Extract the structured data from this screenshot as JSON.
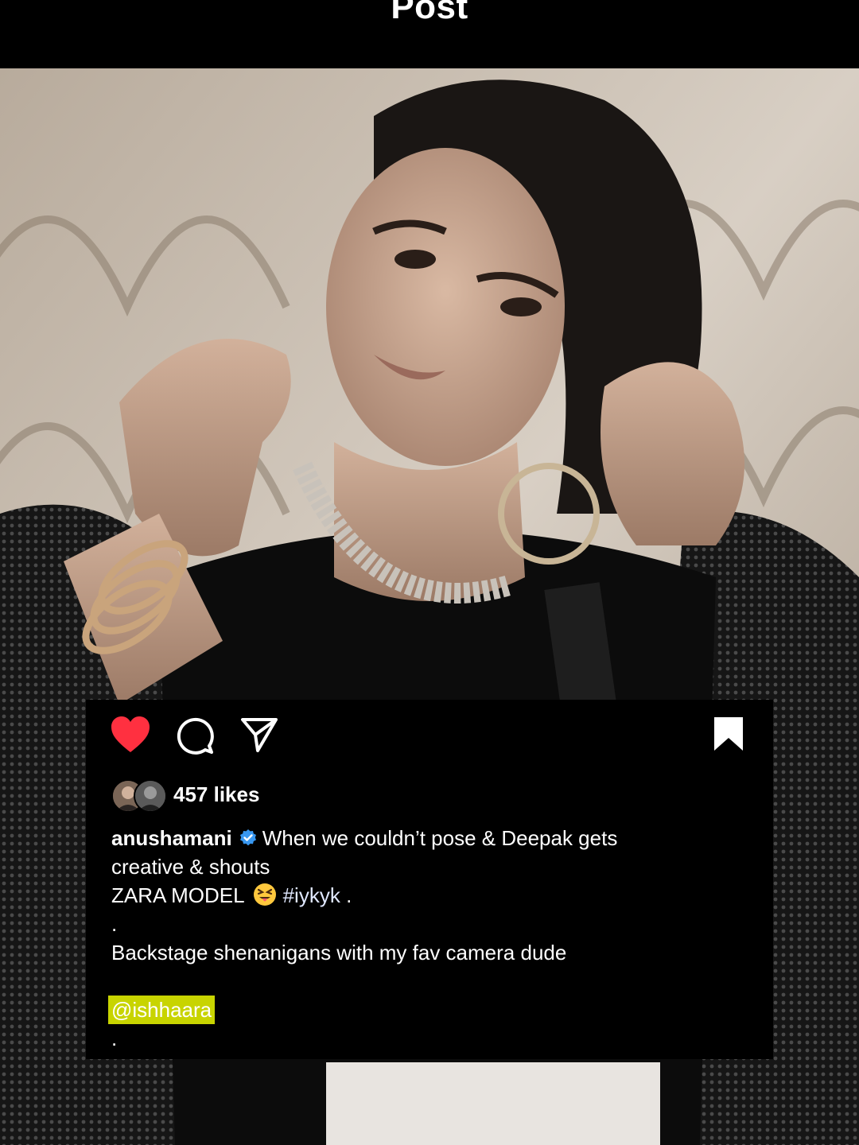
{
  "header": {
    "title": "Post"
  },
  "post": {
    "likes_text": "457 likes",
    "caption": {
      "username": "anushamani",
      "line1": "When we couldn’t pose & Deepak gets",
      "line2": "creative & shouts",
      "line3_text": "ZARA MODEL",
      "line3_hashtag": "#iykyk",
      "line3_end": ".",
      "dot1": ".",
      "line5": "Backstage shenanigans with my fav camera dude",
      "mention": "@ishhaara",
      "dot2": "."
    },
    "icons": {
      "like": "heart-filled-icon",
      "comment": "comment-icon",
      "share": "send-icon",
      "save": "bookmark-filled-icon",
      "verified": "verified-badge-icon",
      "emoji": "squinting-tongue-emoji"
    },
    "colors": {
      "like_red": "#ff3040",
      "verified_blue": "#3897f0",
      "mention_highlight": "#c8d400"
    }
  }
}
